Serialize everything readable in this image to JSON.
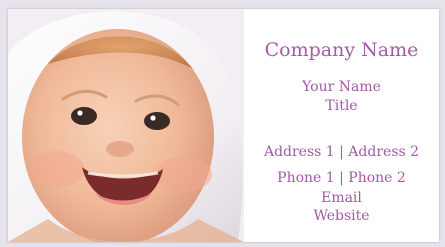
{
  "card": {
    "company_name": "Company Name",
    "your_name": "Your Name",
    "title": "Title",
    "address_line": "Address 1 | Address 2",
    "phone_line": "Phone 1 | Phone 2",
    "email": "Email",
    "website": "Website"
  },
  "photo": {
    "subject": "laughing-baby-in-white-towel"
  },
  "colors": {
    "accent_text": "#a45aa6",
    "card_background": "#ffffff",
    "page_background": "#e7e3ec"
  }
}
